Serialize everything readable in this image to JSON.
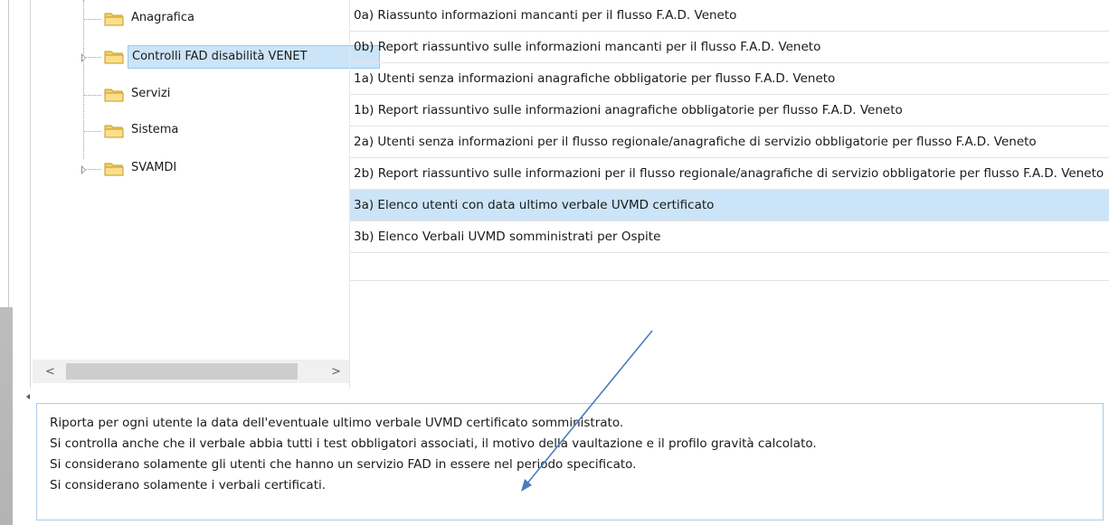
{
  "tree": {
    "items": [
      {
        "label": "Anagrafica",
        "expandable": false
      },
      {
        "label": "Controlli FAD disabilità VENET",
        "expandable": true,
        "selected": true
      },
      {
        "label": "Servizi",
        "expandable": false
      },
      {
        "label": "Sistema",
        "expandable": false
      },
      {
        "label": "SVAMDI",
        "expandable": true
      }
    ],
    "scroll_left": "<",
    "scroll_right": ">"
  },
  "reports": {
    "items": [
      "0a) Riassunto informazioni mancanti per il flusso F.A.D. Veneto",
      "0b) Report riassuntivo sulle informazioni mancanti per il flusso F.A.D. Veneto",
      "1a) Utenti senza informazioni anagrafiche obbligatorie per flusso F.A.D. Veneto",
      "1b) Report riassuntivo sulle informazioni anagrafiche obbligatorie per flusso F.A.D. Veneto",
      "2a) Utenti senza informazioni per il flusso regionale/anagrafiche di servizio obbligatorie per flusso F.A.D. Veneto",
      "2b) Report riassuntivo sulle informazioni per il flusso regionale/anagrafiche di servizio obbligatorie per flusso F.A.D. Veneto",
      "3a) Elenco utenti con data ultimo verbale UVMD certificato",
      "3b) Elenco Verbali UVMD somministrati per Ospite"
    ],
    "selected_index": 6
  },
  "description": {
    "lines": [
      "Riporta per ogni utente la data dell'eventuale ultimo verbale UVMD certificato somministrato.",
      "Si controlla anche che il verbale abbia tutti i test obbligatori associati, il motivo della vaultazione e il profilo gravità calcolato.",
      "Si considerano solamente gli utenti che hanno un servizio FAD in essere nel periodo specificato.",
      "Si considerano solamente i verbali certificati."
    ]
  },
  "colors": {
    "selection": "#cce4f7",
    "selection_border": "#99c9ef",
    "folder": "#f2c94c",
    "arrow": "#4a7ec0"
  }
}
